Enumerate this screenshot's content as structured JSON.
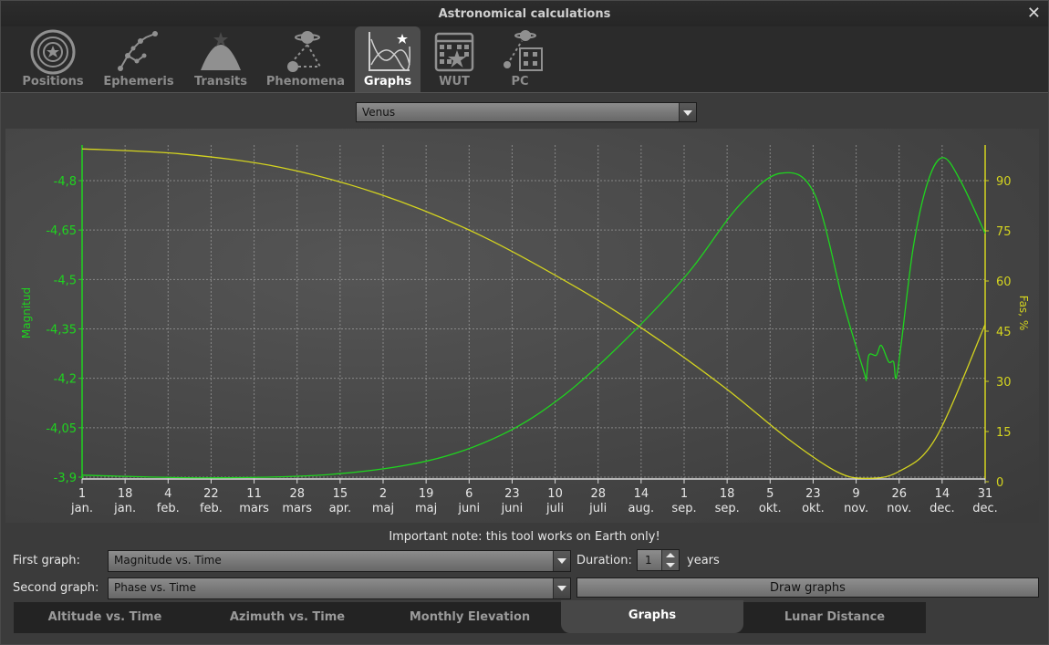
{
  "window": {
    "title": "Astronomical calculations"
  },
  "tabs": [
    {
      "label": "Positions",
      "icon": "positions-icon",
      "active": false
    },
    {
      "label": "Ephemeris",
      "icon": "ephemeris-icon",
      "active": false
    },
    {
      "label": "Transits",
      "icon": "transits-icon",
      "active": false
    },
    {
      "label": "Phenomena",
      "icon": "phenomena-icon",
      "active": false
    },
    {
      "label": "Graphs",
      "icon": "graphs-icon",
      "active": true
    },
    {
      "label": "WUT",
      "icon": "wut-icon",
      "active": false
    },
    {
      "label": "PC",
      "icon": "pc-icon",
      "active": false
    }
  ],
  "object_select": {
    "value": "Venus"
  },
  "chart_data": {
    "type": "line",
    "xlabel": "",
    "x_ticks": [
      [
        "1",
        "jan."
      ],
      [
        "18",
        "jan."
      ],
      [
        "4",
        "feb."
      ],
      [
        "22",
        "feb."
      ],
      [
        "11",
        "mars"
      ],
      [
        "28",
        "mars"
      ],
      [
        "15",
        "apr."
      ],
      [
        "2",
        "maj"
      ],
      [
        "19",
        "maj"
      ],
      [
        "6",
        "juni"
      ],
      [
        "23",
        "juni"
      ],
      [
        "10",
        "juli"
      ],
      [
        "28",
        "juli"
      ],
      [
        "14",
        "aug."
      ],
      [
        "1",
        "sep."
      ],
      [
        "18",
        "sep."
      ],
      [
        "5",
        "okt."
      ],
      [
        "23",
        "okt."
      ],
      [
        "9",
        "nov."
      ],
      [
        "26",
        "nov."
      ],
      [
        "14",
        "dec."
      ],
      [
        "31",
        "dec."
      ]
    ],
    "x_range_days": [
      0,
      365
    ],
    "left_axis": {
      "label": "Magnitud",
      "ticks": [
        "-4,8",
        "-4,65",
        "-4,5",
        "-4,35",
        "-4,2",
        "-4,05",
        "-3,9"
      ],
      "range": [
        -3.9,
        -4.8
      ],
      "reversed": true,
      "color": "#1fd41f"
    },
    "right_axis": {
      "label": "Fas, %",
      "ticks": [
        "90",
        "75",
        "60",
        "45",
        "30",
        "15",
        "0"
      ],
      "range": [
        0,
        100
      ],
      "color": "#d4d41f"
    },
    "grid": true,
    "series": [
      {
        "axis": "left",
        "color": "#1fd41f",
        "points": [
          [
            0,
            -3.906
          ],
          [
            50,
            -3.898
          ],
          [
            100,
            -3.908
          ],
          [
            140,
            -3.95
          ],
          [
            170,
            -4.03
          ],
          [
            195,
            -4.15
          ],
          [
            220,
            -4.32
          ],
          [
            245,
            -4.52
          ],
          [
            265,
            -4.72
          ],
          [
            282,
            -4.822
          ],
          [
            296,
            -4.76
          ],
          [
            308,
            -4.42
          ],
          [
            316,
            -4.22
          ],
          [
            317,
            -4.2
          ],
          [
            318,
            -4.27
          ],
          [
            321,
            -4.27
          ],
          [
            323,
            -4.3
          ],
          [
            326,
            -4.25
          ],
          [
            328,
            -4.25
          ],
          [
            329,
            -4.2
          ],
          [
            331,
            -4.3
          ],
          [
            336,
            -4.6
          ],
          [
            342,
            -4.8
          ],
          [
            348,
            -4.87
          ],
          [
            355,
            -4.8
          ],
          [
            365,
            -4.64
          ]
        ]
      },
      {
        "axis": "right",
        "color": "#d4d41f",
        "points": [
          [
            0,
            99.5
          ],
          [
            40,
            98
          ],
          [
            80,
            94
          ],
          [
            120,
            86
          ],
          [
            160,
            74
          ],
          [
            200,
            58
          ],
          [
            230,
            44
          ],
          [
            260,
            28
          ],
          [
            285,
            13
          ],
          [
            305,
            3
          ],
          [
            317,
            1
          ],
          [
            330,
            3
          ],
          [
            345,
            13
          ],
          [
            365,
            47
          ]
        ]
      }
    ]
  },
  "note": "Important note: this tool works on Earth only!",
  "first_graph": {
    "label": "First graph:",
    "value": "Magnitude vs. Time"
  },
  "duration": {
    "label": "Duration:",
    "value": "1",
    "unit": "years"
  },
  "second_graph": {
    "label": "Second graph:",
    "value": "Phase vs. Time"
  },
  "draw_button": "Draw graphs",
  "bottom_tabs": [
    {
      "label": "Altitude vs. Time",
      "active": false
    },
    {
      "label": "Azimuth vs. Time",
      "active": false
    },
    {
      "label": "Monthly Elevation",
      "active": false
    },
    {
      "label": "Graphs",
      "active": true
    },
    {
      "label": "Lunar Distance",
      "active": false
    }
  ]
}
